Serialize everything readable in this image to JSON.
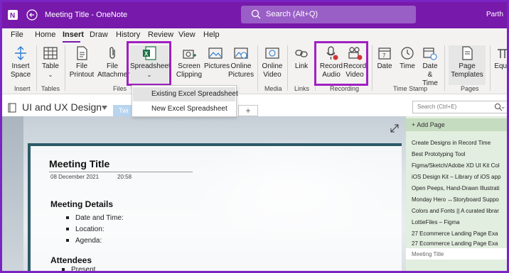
{
  "titlebar": {
    "title": "Meeting Title  -  OneNote",
    "search_placeholder": "Search (Alt+Q)",
    "user": "Parth"
  },
  "menu": [
    "File",
    "Home",
    "Insert",
    "Draw",
    "History",
    "Review",
    "View",
    "Help"
  ],
  "menu_active": "Insert",
  "ribbon": {
    "insert_space": "Insert Space",
    "table": "Table",
    "file_printout": "File Printout",
    "file_attachment": "File Attachment",
    "spreadsheet": "Spreadsheet",
    "screen_clipping": "Screen Clipping",
    "pictures": "Pictures",
    "online_pictures": "Online Pictures",
    "online_video": "Online Video",
    "link": "Link",
    "record_audio": "Record Audio",
    "record_video": "Record Video",
    "date": "Date",
    "time": "Time",
    "date_time": "Date & Time",
    "page_templates": "Page Templates",
    "equation": "Equa",
    "groups": {
      "insert": "Insert",
      "tables": "Tables",
      "files": "Files",
      "media": "Media",
      "links": "Links",
      "recording": "Recording",
      "timestamp": "Time Stamp",
      "pages": "Pages"
    }
  },
  "dropdown": {
    "existing": "Existing Excel Spreadsheet",
    "new": "New Excel Spreadsheet"
  },
  "notebook": {
    "name": "UI and UX Design",
    "section_tab": "Twi",
    "add_section": "+"
  },
  "page_search_placeholder": "Search (Ctrl+E)",
  "page": {
    "title": "Meeting Title",
    "date": "08 December 2021",
    "time": "20:58",
    "h_details": "Meeting Details",
    "details": [
      "Date and Time:",
      "Location:",
      "Agenda:"
    ],
    "h_attendees": "Attendees",
    "attendees": [
      "Present"
    ]
  },
  "pagelist": {
    "add_page": "+ Add Page",
    "pages": [
      "Create Designs in Record Time",
      "Best Prototyping Tool",
      "Figma/Sketch/Adobe XD UI Kit Col",
      "iOS Design Kit – Library of iOS app",
      "Open Peeps, Hand-Drawn Illustrati",
      "Monday Hero ↔Storyboard Suppo",
      "Colors and Fonts || A curated librar",
      "LottieFiles – Figma",
      "27 Ecommerce Landing Page Exa",
      "27 Ecommerce Landing Page Exa"
    ],
    "active": "Meeting Title"
  },
  "colors": {
    "brand": "#7719aa",
    "highlight": "#a020c0",
    "excel": "#1d7044",
    "record": "#d13438"
  }
}
